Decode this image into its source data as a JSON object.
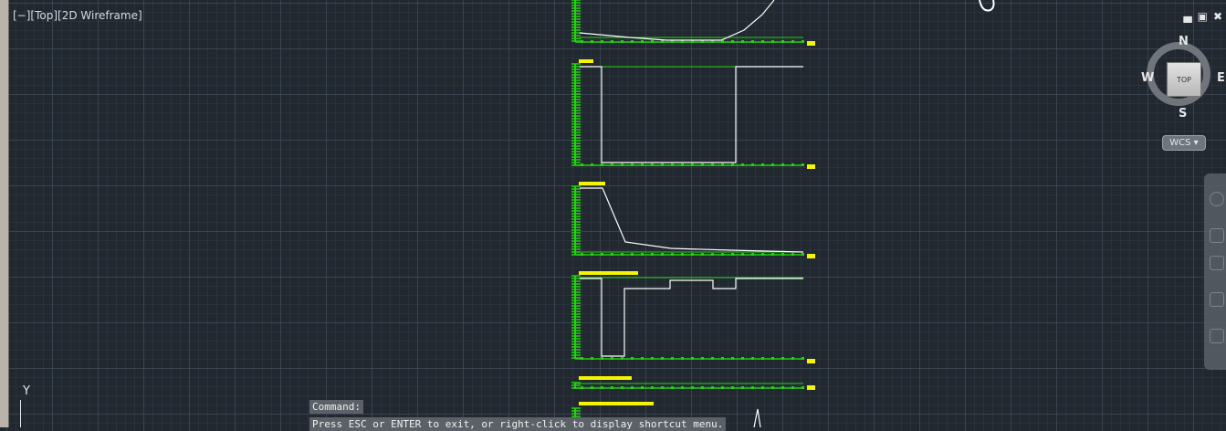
{
  "viewport": {
    "label": "[−][Top][2D Wireframe]"
  },
  "window_controls": {
    "minimize": "▄",
    "restore": "▣",
    "close": "✖"
  },
  "viewcube": {
    "face": "TOP",
    "north": "N",
    "south": "S",
    "east": "E",
    "west": "W",
    "wcs_label": "WCS ▾"
  },
  "ucs": {
    "y_axis": "Y"
  },
  "command": {
    "label": "Command:",
    "message": "Press ESC or ENTER to exit, or right-click to display shortcut menu."
  },
  "colors": {
    "background": "#212830",
    "axis_green": "#22d20f",
    "trace_white": "#ffffff",
    "marker_yellow": "#f5f500"
  }
}
